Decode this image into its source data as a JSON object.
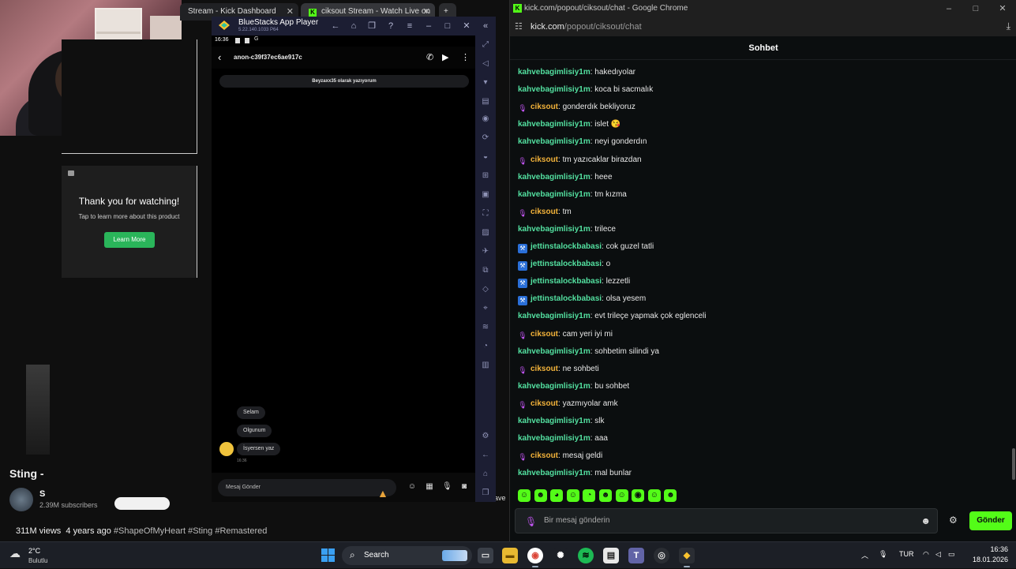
{
  "youtube": {
    "tabs": [
      {
        "label": "Stream - Kick Dashboard"
      },
      {
        "label": "ciksout Stream - Watch Live on"
      }
    ],
    "ad": {
      "title": "Thank you for watching!",
      "subtitle": "Tap to learn more about this product",
      "button": "Learn More"
    },
    "video_title": "Sting -",
    "channel_initial": "S",
    "subscribers": "2.39M subscribers",
    "views": "311M views",
    "age": "4 years ago",
    "hashtags": "#ShapeOfMyHeart #Sting #Remastered",
    "save_label": "ave"
  },
  "bluestacks": {
    "title": "BlueStacks App Player",
    "version": "5.22.140.1033  P64",
    "status_time": "16:36",
    "chat": {
      "partner": "anon-c39f37ec6ae917c",
      "join_banner": "Beyzaxx35 olarak yazıyorum",
      "messages": [
        "Selam",
        "Olgunum",
        "İsyersen yaz"
      ],
      "message_time": "16:36",
      "input_placeholder": "Mesaj Gönder"
    }
  },
  "chrome": {
    "window_title": "kick.com/popout/ciksout/chat - Google Chrome",
    "url_host": "kick.com",
    "url_path": "/popout/ciksout/chat",
    "chat_header": "Sohbet",
    "input_placeholder": "Bir mesaj gönderin",
    "send_label": "Gönder"
  },
  "colors": {
    "kick_green": "#53fc18",
    "user_green": "#53e0a0",
    "user_orange": "#f2b23a",
    "mic_purple": "#c456f5"
  },
  "chat_messages": [
    {
      "user": "kahvebagimlisiy1m",
      "badge": "none",
      "text": "hakedıyolar"
    },
    {
      "user": "kahvebagimlisiy1m",
      "badge": "none",
      "text": "koca bi sacmalık"
    },
    {
      "user": "ciksout",
      "badge": "mic",
      "text": "gonderdık bekliyoruz"
    },
    {
      "user": "kahvebagimlisiy1m",
      "badge": "none",
      "text": "islet 😘"
    },
    {
      "user": "kahvebagimlisiy1m",
      "badge": "none",
      "text": "neyi gonderdın"
    },
    {
      "user": "ciksout",
      "badge": "mic",
      "text": "tm yazıcaklar birazdan"
    },
    {
      "user": "kahvebagimlisiy1m",
      "badge": "none",
      "text": "heee"
    },
    {
      "user": "kahvebagimlisiy1m",
      "badge": "none",
      "text": "tm kızma"
    },
    {
      "user": "ciksout",
      "badge": "mic",
      "text": "tm"
    },
    {
      "user": "kahvebagimlisiy1m",
      "badge": "none",
      "text": "trilece"
    },
    {
      "user": "jettinstalockbabasi",
      "badge": "kick",
      "text": "cok guzel tatli"
    },
    {
      "user": "jettinstalockbabasi",
      "badge": "kick",
      "text": "o"
    },
    {
      "user": "jettinstalockbabasi",
      "badge": "kick",
      "text": "lezzetli"
    },
    {
      "user": "jettinstalockbabasi",
      "badge": "kick",
      "text": "olsa yesem"
    },
    {
      "user": "kahvebagimlisiy1m",
      "badge": "none",
      "text": "evt trileçe yapmak çok eglenceli"
    },
    {
      "user": "ciksout",
      "badge": "mic",
      "text": "cam yeri iyi mi"
    },
    {
      "user": "kahvebagimlisiy1m",
      "badge": "none",
      "text": "sohbetim silindi ya"
    },
    {
      "user": "ciksout",
      "badge": "mic",
      "text": "ne sohbeti"
    },
    {
      "user": "kahvebagimlisiy1m",
      "badge": "none",
      "text": "bu sohbet"
    },
    {
      "user": "ciksout",
      "badge": "mic",
      "text": "yazmıyolar amk"
    },
    {
      "user": "kahvebagimlisiy1m",
      "badge": "none",
      "text": "slk"
    },
    {
      "user": "kahvebagimlisiy1m",
      "badge": "none",
      "text": "aaa"
    },
    {
      "user": "ciksout",
      "badge": "mic",
      "text": "mesaj geldi"
    },
    {
      "user": "kahvebagimlisiy1m",
      "badge": "none",
      "text": "mal bunlar"
    }
  ],
  "taskbar": {
    "weather_temp": "2°C",
    "weather_desc": "Bulutlu",
    "search_label": "Search",
    "lang": "TUR",
    "time": "16:36",
    "date": "18.01.2026"
  }
}
